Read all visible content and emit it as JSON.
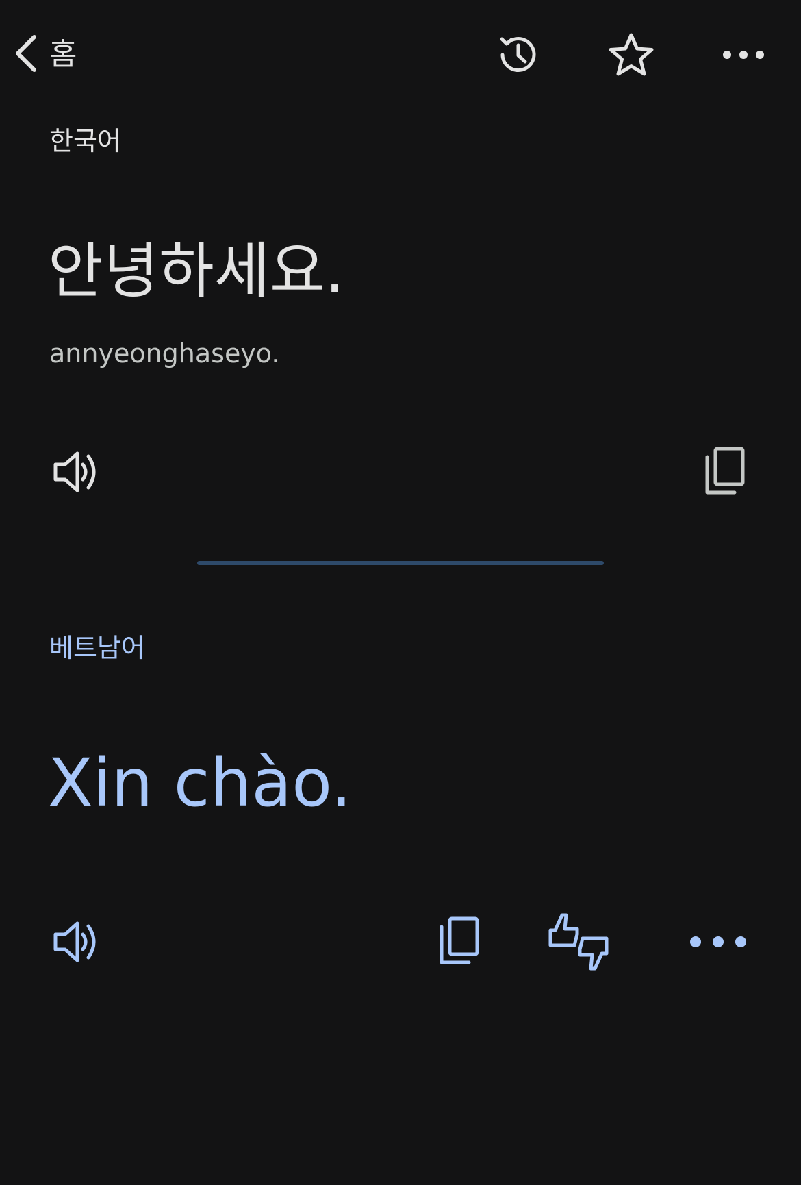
{
  "header": {
    "back_label": "홈",
    "icons": [
      "back-chevron-icon",
      "history-icon",
      "star-icon",
      "more-icon"
    ]
  },
  "source": {
    "language": "한국어",
    "text": "안녕하세요.",
    "transliteration": "annyeonghaseyo.",
    "icons": [
      "speaker-icon",
      "copy-icon"
    ]
  },
  "target": {
    "language": "베트남어",
    "text": "Xin chào.",
    "icons": [
      "speaker-icon",
      "copy-icon",
      "feedback-thumbs-icon",
      "more-icon"
    ]
  },
  "colors": {
    "background": "#131314",
    "primary_text": "#e3e3e3",
    "accent": "#a8c7fa",
    "divider": "#2e4a6a"
  }
}
